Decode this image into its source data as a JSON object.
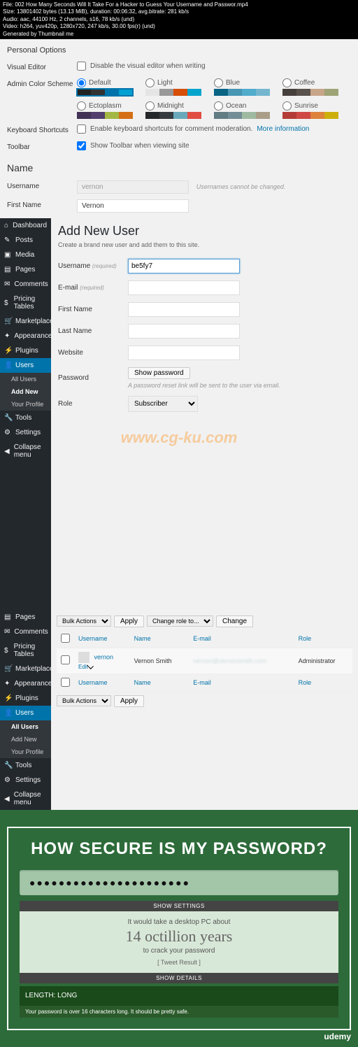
{
  "meta": {
    "file": "File: 002 How Many Seconds Will It Take For a Hacker to Guess Your Username and Passwor.mp4",
    "size": "Size: 13801402 bytes (13.13 MiB), duration: 00:06:32, avg.bitrate: 281 kb/s",
    "audio": "Audio: aac, 44100 Hz, 2 channels, s16, 78 kb/s (und)",
    "video": "Video: h264, yuv420p, 1280x720, 247 kb/s, 30.00 fps(r) (und)",
    "gen": "Generated by Thumbnail me"
  },
  "profile": {
    "personal_options": "Personal Options",
    "visual_editor": "Visual Editor",
    "visual_editor_label": "Disable the visual editor when writing",
    "color_scheme": "Admin Color Scheme",
    "schemes": [
      {
        "name": "Default",
        "colors": [
          "#222",
          "#333",
          "#0073aa",
          "#00a0d2"
        ],
        "selected": true
      },
      {
        "name": "Light",
        "colors": [
          "#e5e5e5",
          "#999",
          "#d64e07",
          "#04a4cc"
        ]
      },
      {
        "name": "Blue",
        "colors": [
          "#096484",
          "#4796b3",
          "#52accc",
          "#74B6CE"
        ]
      },
      {
        "name": "Coffee",
        "colors": [
          "#46403c",
          "#59524c",
          "#c7a589",
          "#9ea476"
        ]
      },
      {
        "name": "Ectoplasm",
        "colors": [
          "#413256",
          "#523f6d",
          "#a3b745",
          "#d46f15"
        ]
      },
      {
        "name": "Midnight",
        "colors": [
          "#25282b",
          "#363b3f",
          "#69a8bb",
          "#e14d43"
        ]
      },
      {
        "name": "Ocean",
        "colors": [
          "#627c83",
          "#738e96",
          "#9ebaa0",
          "#aa9d88"
        ]
      },
      {
        "name": "Sunrise",
        "colors": [
          "#b43c38",
          "#cf4944",
          "#dd823b",
          "#ccaf0b"
        ]
      }
    ],
    "keyboard": "Keyboard Shortcuts",
    "keyboard_label": "Enable keyboard shortcuts for comment moderation.",
    "more_info": "More information",
    "toolbar": "Toolbar",
    "toolbar_label": "Show Toolbar when viewing site",
    "name_heading": "Name",
    "username": "Username",
    "username_val": "vernon",
    "username_note": "Usernames cannot be changed.",
    "first_name": "First Name",
    "first_name_val": "Vernon"
  },
  "wp2": {
    "title": "Add New User",
    "subtitle": "Create a brand new user and add them to this site.",
    "username": "Username",
    "required": "(required)",
    "username_val": "be5fy7",
    "email": "E-mail",
    "first_name": "First Name",
    "last_name": "Last Name",
    "website": "Website",
    "password": "Password",
    "show_password": "Show password",
    "password_note": "A password reset link will be sent to the user via email.",
    "role": "Role",
    "role_val": "Subscriber",
    "watermark": "www.cg-ku.com"
  },
  "sidebar1": [
    {
      "icon": "⌂",
      "label": "Dashboard"
    },
    {
      "icon": "✎",
      "label": "Posts"
    },
    {
      "icon": "▣",
      "label": "Media"
    },
    {
      "icon": "▤",
      "label": "Pages"
    },
    {
      "icon": "✉",
      "label": "Comments"
    },
    {
      "icon": "$",
      "label": "Pricing Tables"
    },
    {
      "icon": "🛒",
      "label": "Marketplace"
    },
    {
      "icon": "✦",
      "label": "Appearance"
    },
    {
      "icon": "⚡",
      "label": "Plugins"
    },
    {
      "icon": "👤",
      "label": "Users",
      "active": true
    }
  ],
  "sidebar1_subs": [
    {
      "label": "All Users"
    },
    {
      "label": "Add New",
      "active": true
    },
    {
      "label": "Your Profile"
    }
  ],
  "sidebar1_tail": [
    {
      "icon": "🔧",
      "label": "Tools"
    },
    {
      "icon": "⚙",
      "label": "Settings"
    }
  ],
  "collapse": "Collapse menu",
  "sidebar2": [
    {
      "icon": "▤",
      "label": "Pages"
    },
    {
      "icon": "✉",
      "label": "Comments"
    },
    {
      "icon": "$",
      "label": "Pricing Tables"
    },
    {
      "icon": "🛒",
      "label": "Marketplace"
    },
    {
      "icon": "✦",
      "label": "Appearance"
    },
    {
      "icon": "⚡",
      "label": "Plugins"
    },
    {
      "icon": "👤",
      "label": "Users",
      "active": true
    }
  ],
  "sidebar2_subs": [
    {
      "label": "All Users",
      "active": true
    },
    {
      "label": "Add New"
    },
    {
      "label": "Your Profile"
    }
  ],
  "sidebar2_tail": [
    {
      "icon": "🔧",
      "label": "Tools"
    },
    {
      "icon": "⚙",
      "label": "Settings"
    }
  ],
  "users_table": {
    "bulk": "Bulk Actions",
    "apply": "Apply",
    "change_role": "Change role to...",
    "change": "Change",
    "cols": {
      "username": "Username",
      "name": "Name",
      "email": "E-mail",
      "role": "Role"
    },
    "row": {
      "username": "vernon",
      "edit": "Edit",
      "name": "Vernon Smith",
      "email": "vernon@vernonsmith.com",
      "role": "Administrator"
    }
  },
  "pw": {
    "title": "HOW SECURE IS MY PASSWORD?",
    "dots": "●●●●●●●●●●●●●●●●●●●●●●",
    "show_settings": "SHOW SETTINGS",
    "detail1": "It would take a desktop PC about",
    "big": "14 octillion years",
    "detail2": "to crack your password",
    "tweet": "[ Tweet Result ]",
    "show_details": "SHOW DETAILS",
    "length": "LENGTH: LONG",
    "length_desc": "Your password is over 16 characters long. It should be pretty safe.",
    "udemy": "udemy"
  }
}
